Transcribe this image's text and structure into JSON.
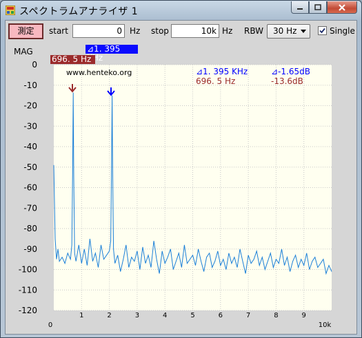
{
  "window": {
    "title": "スペクトラムアナライザ 1"
  },
  "toolbar": {
    "measure_label": "測定",
    "start_label": "start",
    "start_value": "0",
    "start_unit": "Hz",
    "stop_label": "stop",
    "stop_value": "10k",
    "stop_unit": "Hz",
    "rbw_label": "RBW",
    "rbw_value": "30 Hz",
    "single_label": "Single",
    "single_checked": true
  },
  "markers": {
    "blue_tag": "⊿1. 395 KHz",
    "red_tag": "696. 5 Hz",
    "blue_freq": "⊿1. 395 KHz",
    "blue_level": "⊿-1.65dB",
    "red_freq": "696. 5 Hz",
    "red_level": "-13.6dB"
  },
  "plot": {
    "watermark": "www.henteko.org",
    "mag_label": "MAG",
    "x_start_label": "0",
    "x_end_label": "10k"
  },
  "colors": {
    "trace": "#1a7fd8",
    "blue_marker": "#0000ff",
    "red_marker": "#9b2b2b",
    "plot_bg": "#fffff0",
    "grid": "#c8c8c8"
  },
  "chart_data": {
    "type": "line",
    "xlabel": "",
    "ylabel": "MAG",
    "x_ticks": [
      "0",
      "1",
      "2",
      "3",
      "4",
      "5",
      "6",
      "7",
      "8",
      "9",
      "10k"
    ],
    "y_ticks": [
      0,
      -10,
      -20,
      -30,
      -40,
      -50,
      -60,
      -70,
      -80,
      -90,
      -100,
      -110,
      -120
    ],
    "xlim": [
      0,
      10
    ],
    "ylim": [
      -120,
      0
    ],
    "grid": true,
    "series": [
      {
        "x": [
          0.0,
          0.05,
          0.1,
          0.15,
          0.2,
          0.3,
          0.4,
          0.5,
          0.6,
          0.65,
          0.68,
          0.7,
          0.72,
          0.75,
          0.8,
          0.9,
          1.0,
          1.1,
          1.2,
          1.3,
          1.4,
          1.5,
          1.6,
          1.7,
          1.8,
          1.9,
          2.0,
          2.05,
          2.08,
          2.1,
          2.12,
          2.15,
          2.2,
          2.3,
          2.4,
          2.5,
          2.6,
          2.7,
          2.8,
          2.9,
          3.0,
          3.1,
          3.2,
          3.3,
          3.4,
          3.5,
          3.6,
          3.7,
          3.8,
          3.9,
          4.0,
          4.1,
          4.2,
          4.3,
          4.4,
          4.5,
          4.6,
          4.7,
          4.8,
          4.9,
          5.0,
          5.1,
          5.2,
          5.3,
          5.4,
          5.5,
          5.6,
          5.7,
          5.8,
          5.9,
          6.0,
          6.1,
          6.2,
          6.3,
          6.4,
          6.5,
          6.6,
          6.7,
          6.8,
          6.9,
          7.0,
          7.1,
          7.2,
          7.3,
          7.4,
          7.5,
          7.6,
          7.7,
          7.8,
          7.9,
          8.0,
          8.1,
          8.2,
          8.3,
          8.4,
          8.5,
          8.6,
          8.7,
          8.8,
          8.9,
          9.0,
          9.1,
          9.2,
          9.3,
          9.4,
          9.5,
          9.6,
          9.7,
          9.8,
          9.9,
          10.0
        ],
        "y": [
          -49,
          -85,
          -95,
          -90,
          -96,
          -94,
          -97,
          -92,
          -95,
          -88,
          -50,
          -13.6,
          -55,
          -92,
          -96,
          -88,
          -97,
          -90,
          -98,
          -85,
          -96,
          -92,
          -99,
          -88,
          -95,
          -93,
          -91,
          -86,
          -48,
          -15,
          -52,
          -90,
          -97,
          -93,
          -101,
          -95,
          -88,
          -99,
          -94,
          -96,
          -91,
          -100,
          -89,
          -97,
          -93,
          -99,
          -86,
          -95,
          -102,
          -91,
          -97,
          -94,
          -90,
          -100,
          -96,
          -92,
          -99,
          -88,
          -97,
          -95,
          -93,
          -98,
          -90,
          -96,
          -101,
          -94,
          -92,
          -99,
          -96,
          -91,
          -98,
          -95,
          -100,
          -92,
          -97,
          -94,
          -99,
          -90,
          -96,
          -102,
          -93,
          -97,
          -95,
          -91,
          -98,
          -94,
          -100,
          -96,
          -92,
          -99,
          -95,
          -97,
          -90,
          -98,
          -94,
          -101,
          -96,
          -93,
          -99,
          -95,
          -98,
          -92,
          -100,
          -96,
          -94,
          -99,
          -97,
          -95,
          -102,
          -98,
          -101
        ]
      }
    ]
  }
}
